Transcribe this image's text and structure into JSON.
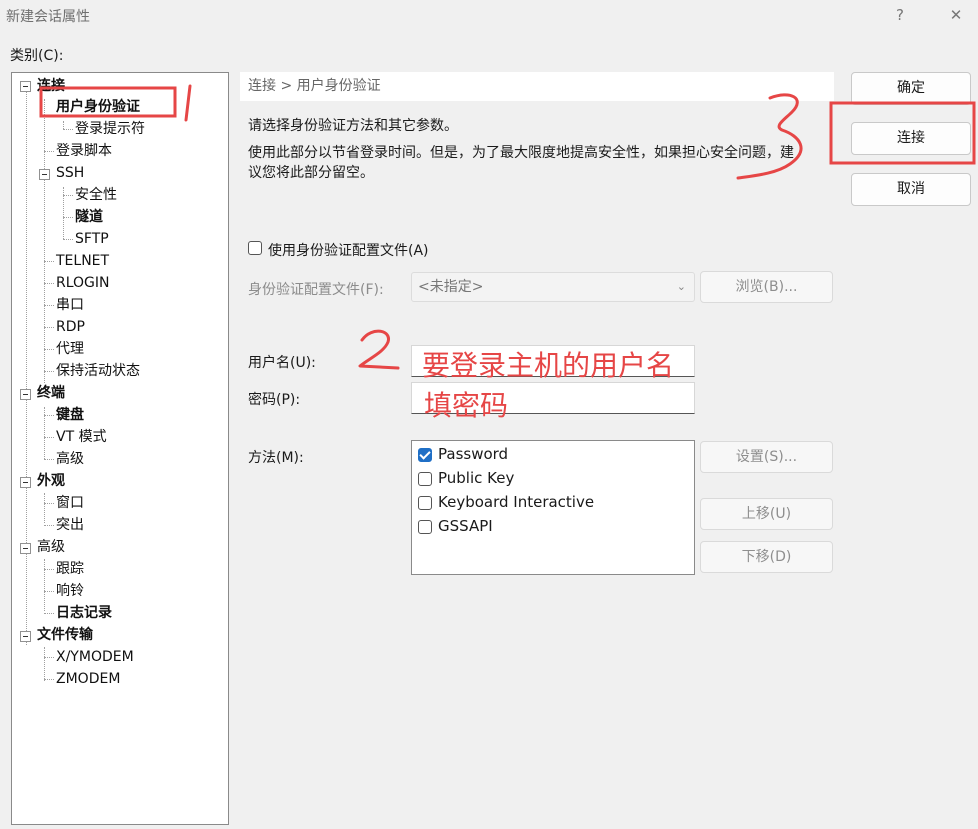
{
  "window": {
    "title": "新建会话属性",
    "help_glyph": "?",
    "close_glyph": "✕"
  },
  "category_label": "类别(C):",
  "tree": {
    "items": [
      {
        "label": "连接",
        "bold": true
      },
      {
        "label": "用户身份验证",
        "bold": true
      },
      {
        "label": "登录提示符",
        "bold": false
      },
      {
        "label": "登录脚本",
        "bold": false
      },
      {
        "label": "SSH",
        "bold": false
      },
      {
        "label": "安全性",
        "bold": false
      },
      {
        "label": "隧道",
        "bold": true
      },
      {
        "label": "SFTP",
        "bold": false
      },
      {
        "label": "TELNET",
        "bold": false
      },
      {
        "label": "RLOGIN",
        "bold": false
      },
      {
        "label": "串口",
        "bold": false
      },
      {
        "label": "RDP",
        "bold": false
      },
      {
        "label": "代理",
        "bold": false
      },
      {
        "label": "保持活动状态",
        "bold": false
      },
      {
        "label": "终端",
        "bold": true
      },
      {
        "label": "键盘",
        "bold": true
      },
      {
        "label": "VT 模式",
        "bold": false
      },
      {
        "label": "高级",
        "bold": false
      },
      {
        "label": "外观",
        "bold": true
      },
      {
        "label": "窗口",
        "bold": false
      },
      {
        "label": "突出",
        "bold": false
      },
      {
        "label": "高级",
        "bold": false
      },
      {
        "label": "跟踪",
        "bold": false
      },
      {
        "label": "响铃",
        "bold": false
      },
      {
        "label": "日志记录",
        "bold": true
      },
      {
        "label": "文件传输",
        "bold": true
      },
      {
        "label": "X/YMODEM",
        "bold": false
      },
      {
        "label": "ZMODEM",
        "bold": false
      }
    ]
  },
  "panel": {
    "breadcrumb": "连接 > 用户身份验证",
    "desc1": "请选择身份验证方法和其它参数。",
    "desc2_line1": "使用此部分以节省登录时间。但是，为了最大限度地提高安全性，如果担心安全问题，建",
    "desc2_line2": "议您将此部分留空。",
    "use_profile_label": "使用身份验证配置文件(A)",
    "use_profile_checked": false,
    "profile_label": "身份验证配置文件(F):",
    "profile_value": "<未指定>",
    "browse_button": "浏览(B)...",
    "username_label": "用户名(U):",
    "username_value": "",
    "password_label": "密码(P):",
    "password_value": "",
    "method_label": "方法(M):",
    "methods": [
      {
        "label": "Password",
        "checked": true
      },
      {
        "label": "Public Key",
        "checked": false
      },
      {
        "label": "Keyboard Interactive",
        "checked": false
      },
      {
        "label": "GSSAPI",
        "checked": false
      }
    ],
    "settings_button": "设置(S)...",
    "move_up_button": "上移(U)",
    "move_down_button": "下移(D)"
  },
  "buttons": {
    "ok": "确定",
    "connect": "连接",
    "cancel": "取消"
  },
  "annotations": {
    "username_hint": "要登录主机的用户名",
    "password_hint": "填密码",
    "color": "#e64646"
  }
}
